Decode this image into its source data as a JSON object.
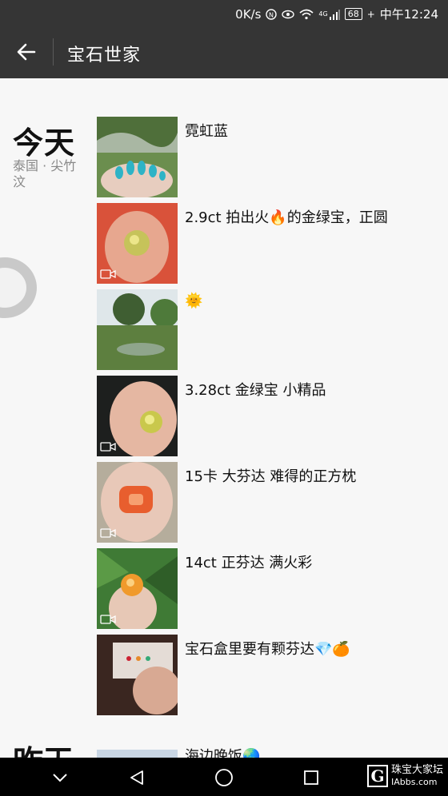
{
  "status": {
    "speed": "0K/s",
    "signal": "4G",
    "battery": "68",
    "time": "中午12:24"
  },
  "header": {
    "title": "宝石世家"
  },
  "day": {
    "label": "今天",
    "location": "泰国 · 尖竹汶"
  },
  "posts": [
    {
      "text": "霓虹蓝"
    },
    {
      "text": "2.9ct 拍出火🔥的金绿宝，正圆"
    },
    {
      "text": "🌞"
    },
    {
      "text": "3.28ct 金绿宝 小精品"
    },
    {
      "text": "15卡 大芬达 难得的正方枕"
    },
    {
      "text": "14ct 正芬达 满火彩"
    },
    {
      "text": "宝石盒里要有颗芬达💎🍊"
    }
  ],
  "next_day": {
    "label": "昨天",
    "first_post": "海边晚饭🌏"
  },
  "watermark": {
    "logo": "G",
    "line1": "珠宝大家坛",
    "line2": "IAbbs.com"
  },
  "icons": [
    "back-arrow-icon",
    "video-icon",
    "nav-back-icon",
    "nav-home-icon",
    "nav-recents-icon",
    "nav-collapse-icon"
  ]
}
